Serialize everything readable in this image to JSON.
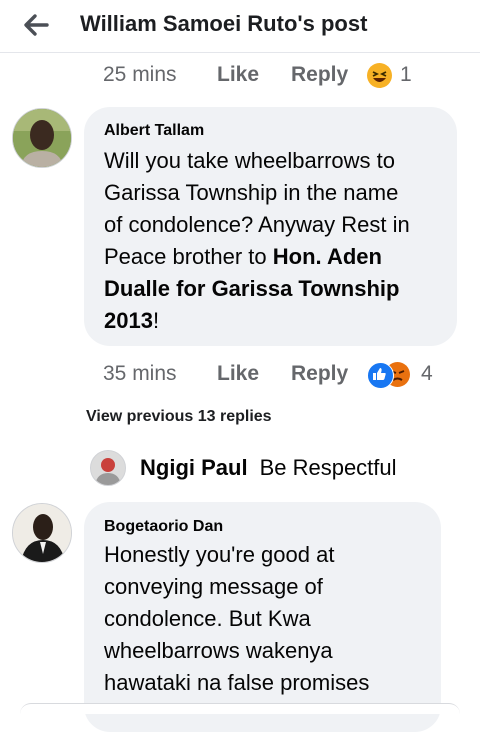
{
  "header": {
    "title": "William Samoei Ruto's post"
  },
  "prev_comment_meta": {
    "time": "25 mins",
    "like": "Like",
    "reply": "Reply",
    "reaction_count": "1",
    "reaction_icon": "haha-emoji-icon"
  },
  "comment1": {
    "author": "Albert Tallam",
    "line1": "Will you take wheelbarrows to",
    "line2": "Garissa Township in the name",
    "line3": "of condolence? Anyway Rest in",
    "line4_plain": "Peace brother to ",
    "line4_bold": "Hon. Aden",
    "line5_bold": "Dualle for Garissa Township",
    "line6_bold": "2013",
    "line6_plain": "!",
    "meta": {
      "time": "35 mins",
      "like": "Like",
      "reply": "Reply",
      "reaction_count": "4"
    },
    "reaction_colors": {
      "like": "#1877f2",
      "angry": "#e9710f"
    }
  },
  "view_previous": "View previous 13 replies",
  "reply_preview": {
    "name": "Ngigi Paul",
    "text": "Be Respectful"
  },
  "comment2": {
    "author": "Bogetaorio Dan",
    "lines": [
      "Honestly you're good at",
      "conveying message of",
      "condolence. But Kwa",
      "wheelbarrows wakenya",
      "hawataki na false promises"
    ]
  }
}
